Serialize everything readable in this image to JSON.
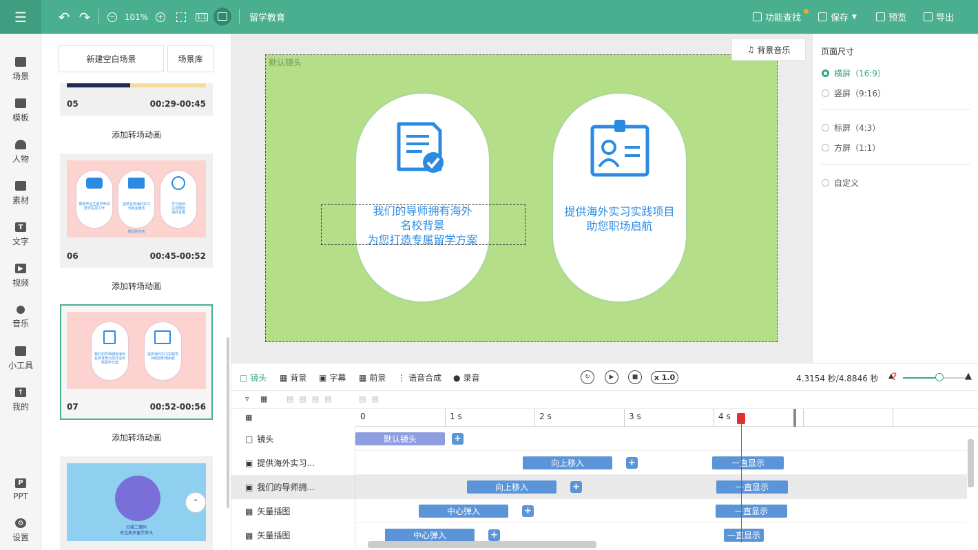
{
  "toolbar": {
    "zoom": "101%",
    "fit_label": "1:1",
    "project_name": "留学教育",
    "find_label": "功能查找",
    "save_label": "保存",
    "preview_label": "预览",
    "export_label": "导出"
  },
  "nav": [
    {
      "label": "场景",
      "icon": "scene-icon"
    },
    {
      "label": "模板",
      "icon": "template-icon"
    },
    {
      "label": "人物",
      "icon": "person-icon"
    },
    {
      "label": "素材",
      "icon": "asset-icon"
    },
    {
      "label": "文字",
      "icon": "text-icon"
    },
    {
      "label": "视频",
      "icon": "video-icon"
    },
    {
      "label": "音乐",
      "icon": "music-icon"
    },
    {
      "label": "小工具",
      "icon": "tools-icon"
    },
    {
      "label": "我的",
      "icon": "my-icon"
    },
    {
      "label": "PPT",
      "icon": "ppt-icon"
    },
    {
      "label": "设置",
      "icon": "settings-icon"
    }
  ],
  "scenes": {
    "new_label": "新建空白场景",
    "lib_label": "场景库",
    "transition_label": "添加转场动画",
    "cards": [
      {
        "num": "05",
        "time": "00:29-00:45"
      },
      {
        "num": "06",
        "time": "00:45-00:52"
      },
      {
        "num": "07",
        "time": "00:52-00:56"
      }
    ],
    "thumb6": {
      "caption": "我们的任务",
      "texts": [
        "帮助毕业生留学申请\n帮学生找工作",
        "提供名校海外实习\n与就业服务",
        "学习培训\n生涯规划\n海外发展"
      ]
    },
    "thumb7": {
      "texts": [
        "我们的导师拥有海外名校背景为您打造专属留学方案",
        "提供海外实习实践项目助您职场启航"
      ]
    },
    "thumb8": {
      "caption1": "扫描二维码",
      "caption2": "关注更多留学资讯"
    }
  },
  "stage": {
    "label": "默认镜头",
    "bgm_label": "背景音乐",
    "left_text": [
      "我们的导师拥有海外",
      "名校背景",
      "为您打造专属留学方案"
    ],
    "right_text": [
      "提供海外实习实践项目",
      "助您职场启航"
    ],
    "bg_color": "#b5de88",
    "accent": "#2b8be3"
  },
  "page_size": {
    "title": "页面尺寸",
    "options": [
      {
        "label": "横屏（16:9）",
        "selected": true
      },
      {
        "label": "竖屏（9:16）",
        "selected": false
      },
      {
        "label": "标屏（4:3）",
        "selected": false
      },
      {
        "label": "方屏（1:1）",
        "selected": false
      },
      {
        "label": "自定义",
        "selected": false
      }
    ]
  },
  "timeline": {
    "tabs": [
      "镜头",
      "背景",
      "字幕",
      "前景",
      "语音合成",
      "录音"
    ],
    "speed": "x 1.0",
    "time_readout": "4.3154 秒/4.8846 秒",
    "ticks": [
      "0",
      "1 s",
      "2 s",
      "3 s",
      "4 s"
    ],
    "tracks": [
      {
        "label": "镜头",
        "icon": "camera-icon"
      },
      {
        "label": "提供海外实习...",
        "icon": "text-box-icon"
      },
      {
        "label": "我们的导师拥...",
        "icon": "text-box-icon"
      },
      {
        "label": "矢量插图",
        "icon": "vector-icon"
      },
      {
        "label": "矢量插图",
        "icon": "vector-icon"
      }
    ],
    "clips": {
      "cam": "默认镜头",
      "up": "向上移入",
      "always": "一直显示",
      "center": "中心弹入",
      "plus": "+"
    }
  }
}
